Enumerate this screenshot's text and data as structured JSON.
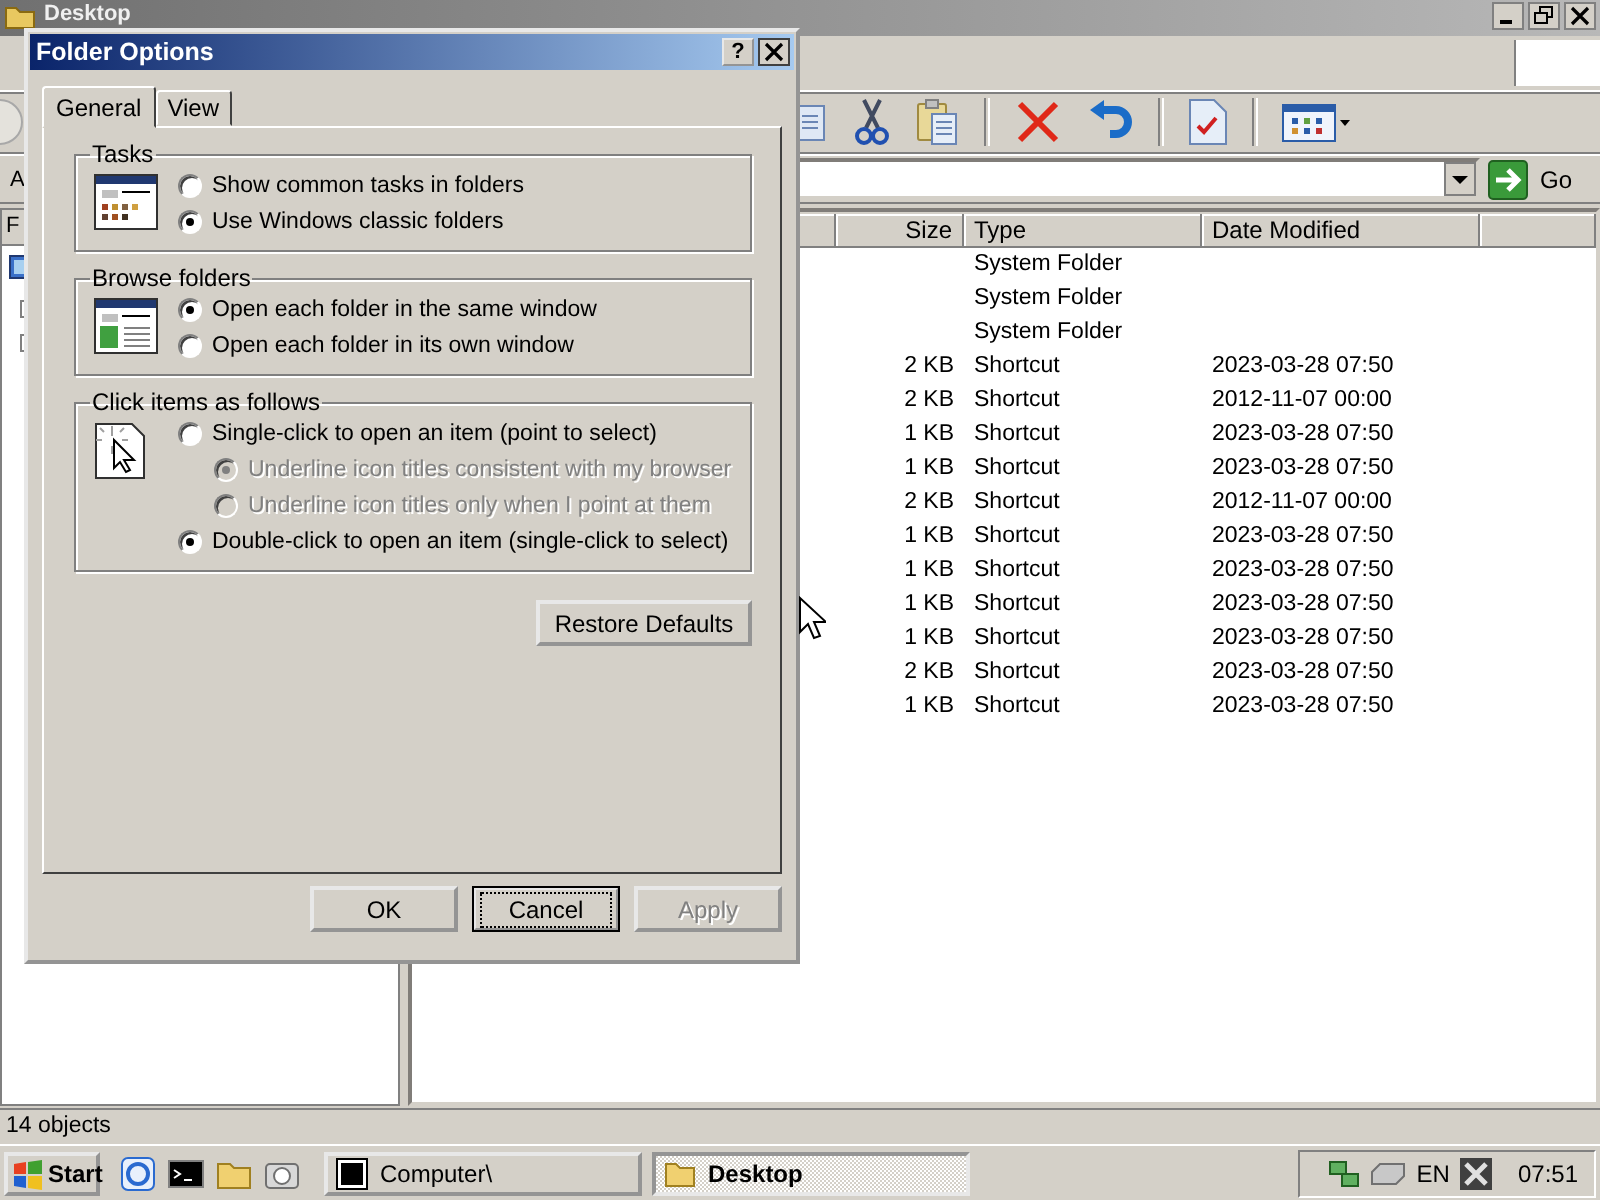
{
  "explorer": {
    "title": "Desktop",
    "address_label": "A",
    "go_button": "Go",
    "folders_header": "F",
    "columns": [
      "Size",
      "Type",
      "Date Modified"
    ],
    "rows": [
      {
        "type": "System Folder"
      },
      {
        "type": "System Folder"
      },
      {
        "type": "System Folder"
      },
      {
        "size": "2 KB",
        "type": "Shortcut",
        "date": "2023-03-28 07:50"
      },
      {
        "size": "2 KB",
        "type": "Shortcut",
        "date": "2012-11-07 00:00"
      },
      {
        "size": "1 KB",
        "type": "Shortcut",
        "date": "2023-03-28 07:50"
      },
      {
        "size": "1 KB",
        "type": "Shortcut",
        "date": "2023-03-28 07:50"
      },
      {
        "size": "2 KB",
        "type": "Shortcut",
        "date": "2012-11-07 00:00"
      },
      {
        "size": "1 KB",
        "type": "Shortcut",
        "date": "2023-03-28 07:50"
      },
      {
        "size": "1 KB",
        "type": "Shortcut",
        "date": "2023-03-28 07:50"
      },
      {
        "size": "1 KB",
        "type": "Shortcut",
        "date": "2023-03-28 07:50"
      },
      {
        "size": "1 KB",
        "type": "Shortcut",
        "date": "2023-03-28 07:50"
      },
      {
        "size": "2 KB",
        "type": "Shortcut",
        "date": "2023-03-28 07:50"
      },
      {
        "size": "1 KB",
        "type": "Shortcut",
        "date": "2023-03-28 07:50"
      }
    ],
    "status": "14 objects"
  },
  "dialog": {
    "title": "Folder Options",
    "help_button": "?",
    "tabs": [
      {
        "label": "General",
        "selected": true
      },
      {
        "label": "View",
        "selected": false
      }
    ],
    "groups": [
      {
        "title": "Tasks",
        "options": [
          {
            "label": "Show common tasks in folders",
            "selected": false,
            "disabled": false
          },
          {
            "label": "Use Windows classic folders",
            "selected": true,
            "disabled": false
          }
        ]
      },
      {
        "title": "Browse folders",
        "options": [
          {
            "label": "Open each folder in the same window",
            "selected": true,
            "disabled": false
          },
          {
            "label": "Open each folder in its own window",
            "selected": false,
            "disabled": false
          }
        ]
      },
      {
        "title": "Click items as follows",
        "options": [
          {
            "label": "Single-click to open an item (point to select)",
            "selected": false,
            "disabled": false,
            "children": [
              {
                "label": "Underline icon titles consistent with my browser",
                "selected": true,
                "disabled": true
              },
              {
                "label": "Underline icon titles only when I point at them",
                "selected": false,
                "disabled": true
              }
            ]
          },
          {
            "label": "Double-click to open an item (single-click to select)",
            "selected": true,
            "disabled": false
          }
        ]
      }
    ],
    "restore_button": "Restore Defaults",
    "buttons": [
      {
        "label": "OK",
        "focused": false,
        "disabled": false
      },
      {
        "label": "Cancel",
        "focused": true,
        "disabled": false
      },
      {
        "label": "Apply",
        "focused": false,
        "disabled": true
      }
    ]
  },
  "taskbar": {
    "start_button": "Start",
    "tasks": [
      {
        "label": "Computer\\",
        "selected": false
      },
      {
        "label": "Desktop",
        "selected": true
      }
    ],
    "language": "EN",
    "clock": "07:51"
  }
}
